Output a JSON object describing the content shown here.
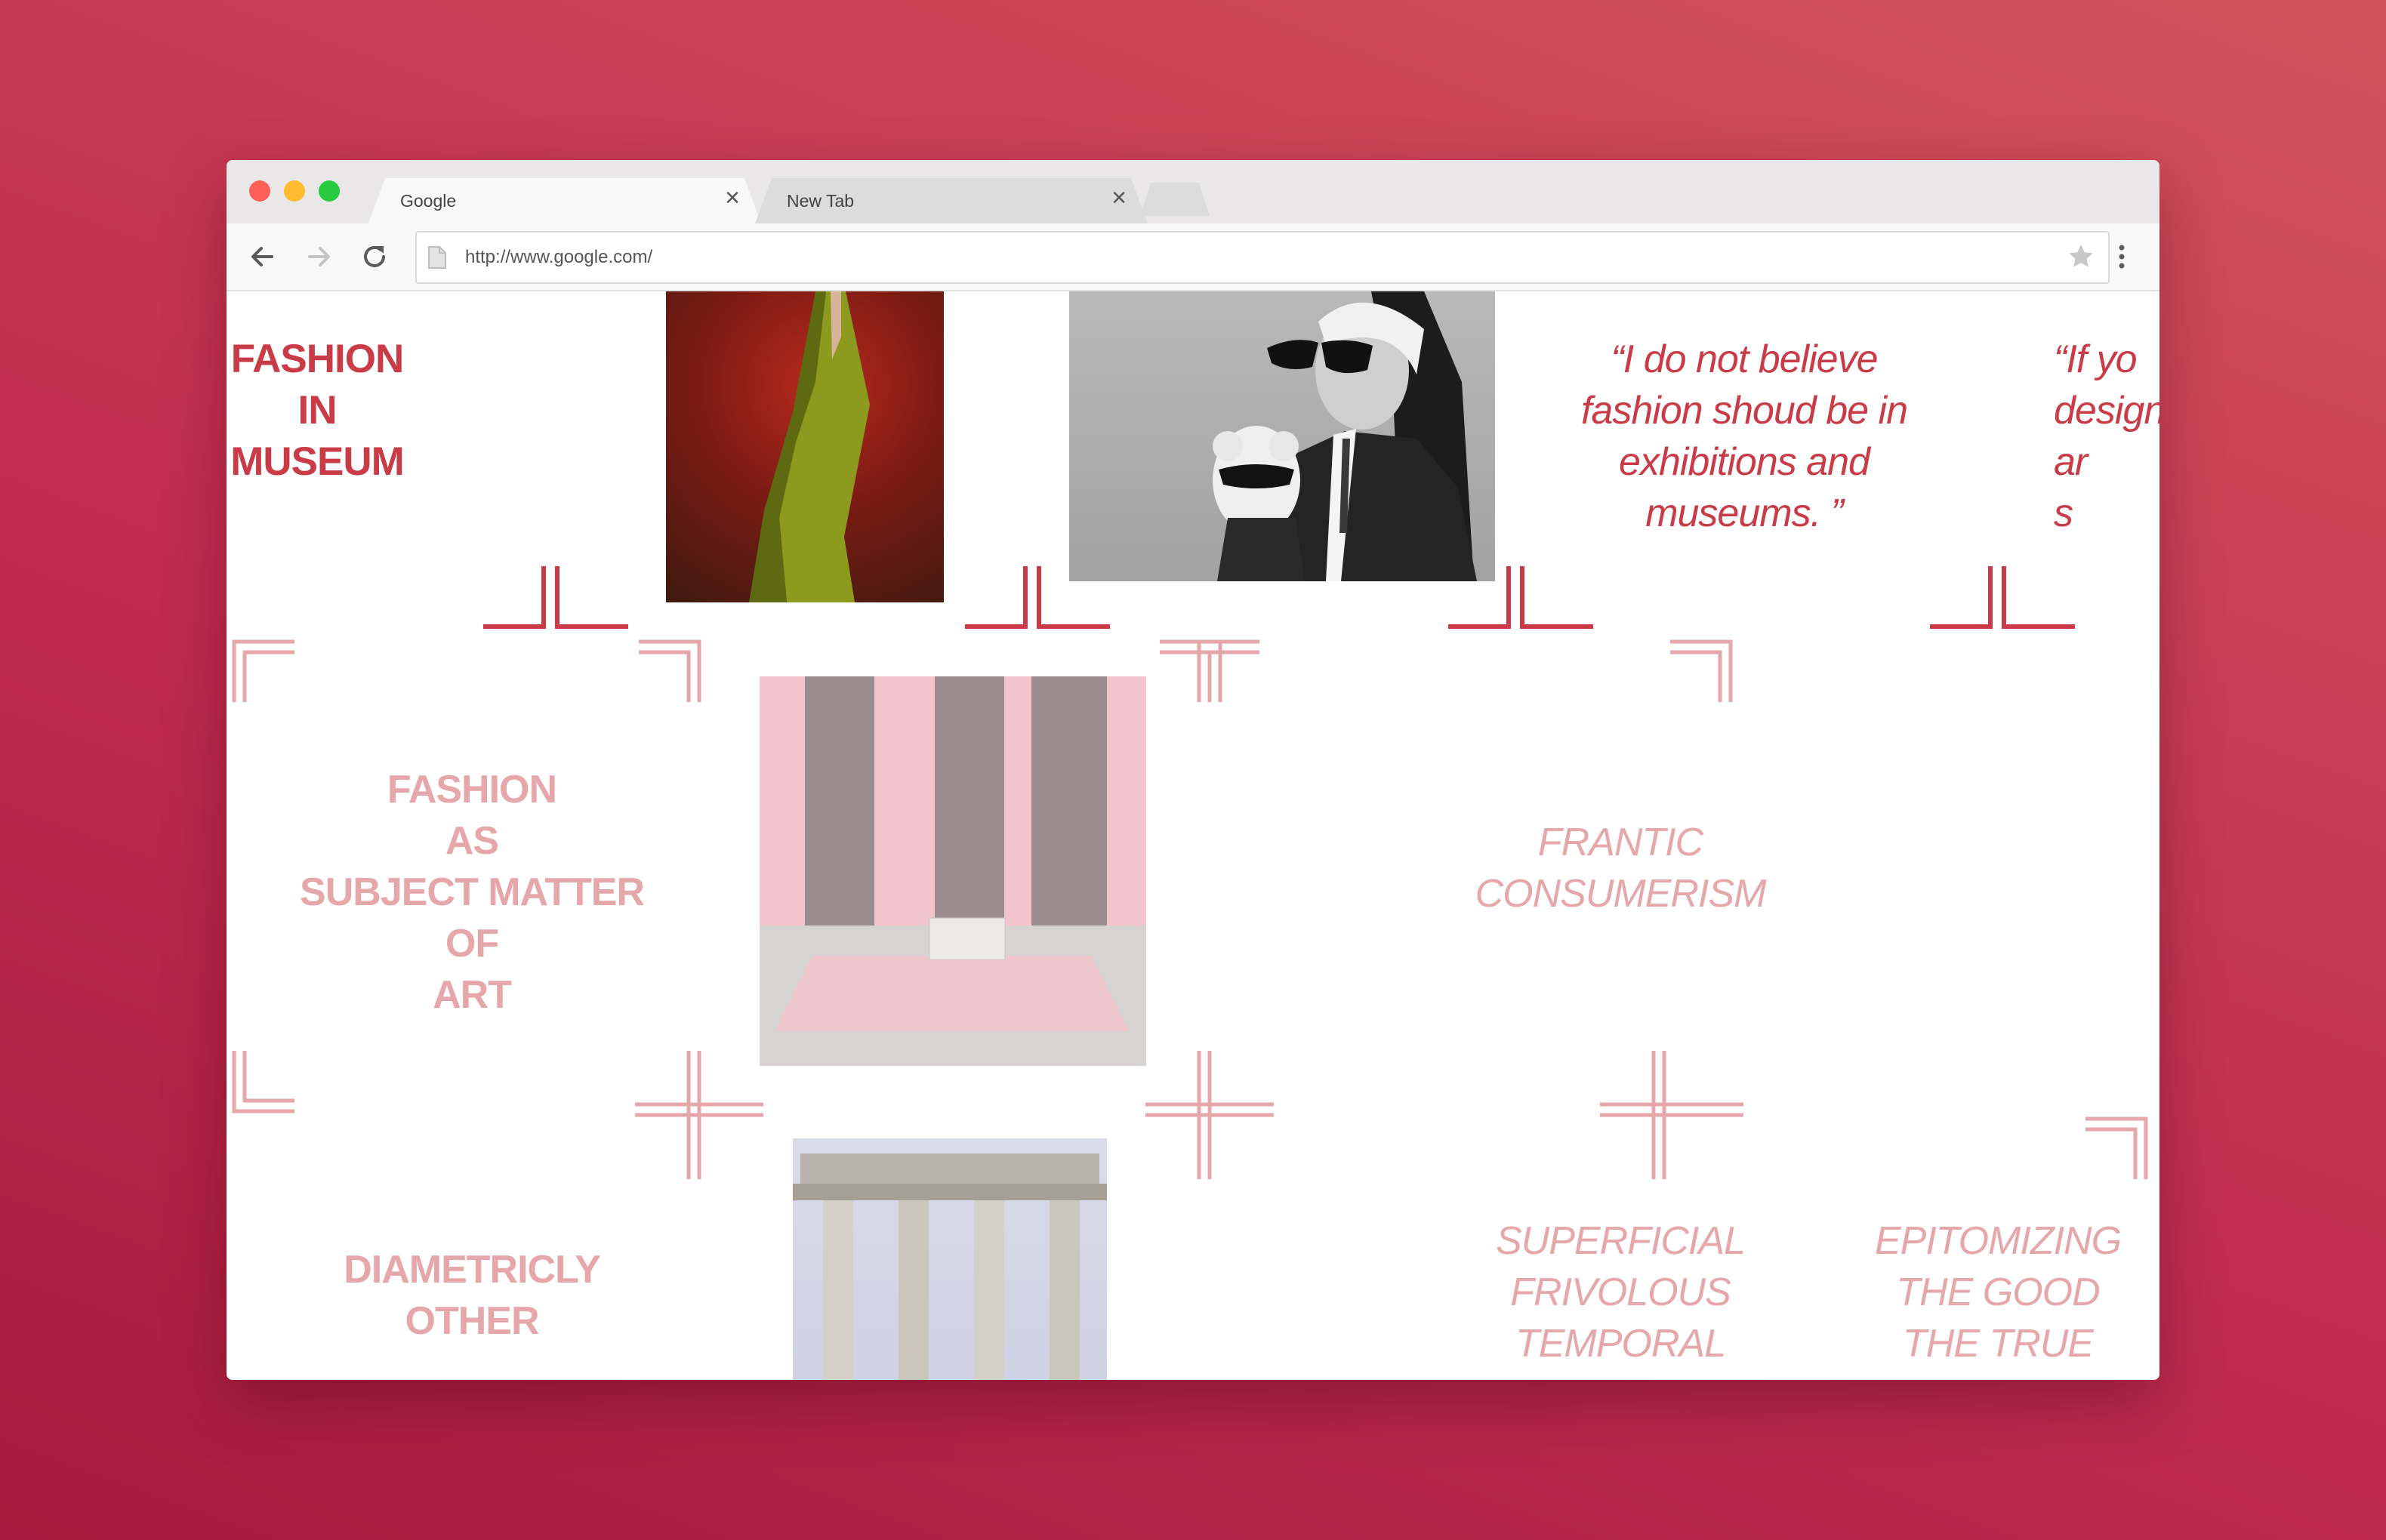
{
  "browser": {
    "tabs": [
      {
        "label": "Google",
        "close": "×"
      },
      {
        "label": "New Tab",
        "close": "×"
      }
    ],
    "url": "http://www.google.com/"
  },
  "page": {
    "heading": "FASHION\nIN\nMUSEUM",
    "quote_1": "“I do not believe\nfashion shoud be in\nexhibitions and\nmuseums. ”",
    "quote_2": "“If yo\ndesign\nar\ns",
    "section_1": "FASHION\nAS\nSUBJECT MATTER\nOF\nART",
    "frantic": "FRANTIC\nCONSUMERISM",
    "diametric": "DIAMETRICLY\nOTHER",
    "superficial": "SUPERFICIAL\nFRIVOLOUS\nTEMPORAL",
    "epitomizing": "EPITOMIZING\nTHE GOOD\nTHE TRUE"
  },
  "colors": {
    "background": "#b82545",
    "accent_deep": "#c83b47",
    "accent_soft": "#e6a7aa"
  }
}
